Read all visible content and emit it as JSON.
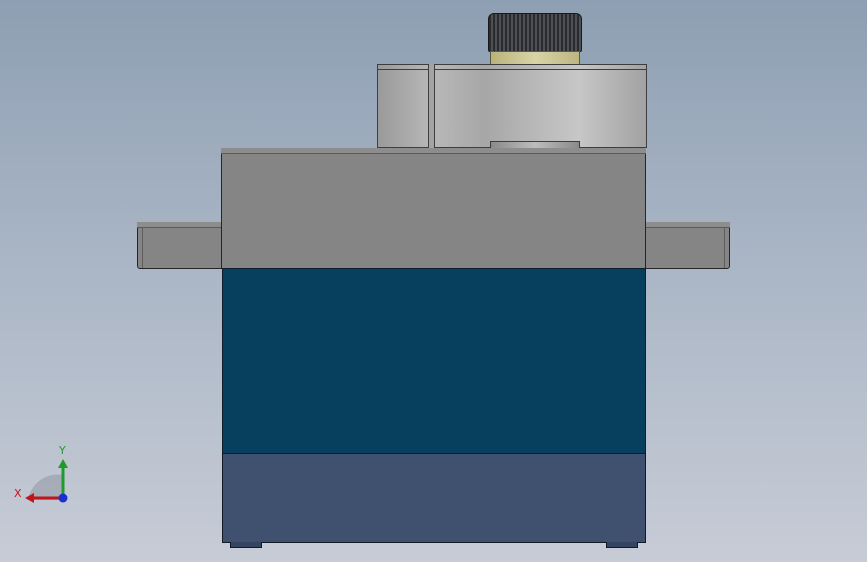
{
  "viewport": {
    "background_top": "#8e9fb3",
    "background_bottom": "#c7ccd6"
  },
  "model": {
    "parts": [
      {
        "name": "output-spline-knob",
        "color": "#2a2b2f"
      },
      {
        "name": "shaft-collar",
        "color": "#d9d4a6"
      },
      {
        "name": "gear-housing",
        "color": "#b8b8b8"
      },
      {
        "name": "top-case",
        "color": "#858585"
      },
      {
        "name": "middle-case",
        "color": "#073f5e"
      },
      {
        "name": "bottom-cap",
        "color": "#3f516f"
      }
    ]
  },
  "triad": {
    "x_label": "X",
    "y_label": "Y",
    "x_color": "#c0151a",
    "y_color": "#1f9a2c",
    "z_color": "#1a2fd0"
  }
}
